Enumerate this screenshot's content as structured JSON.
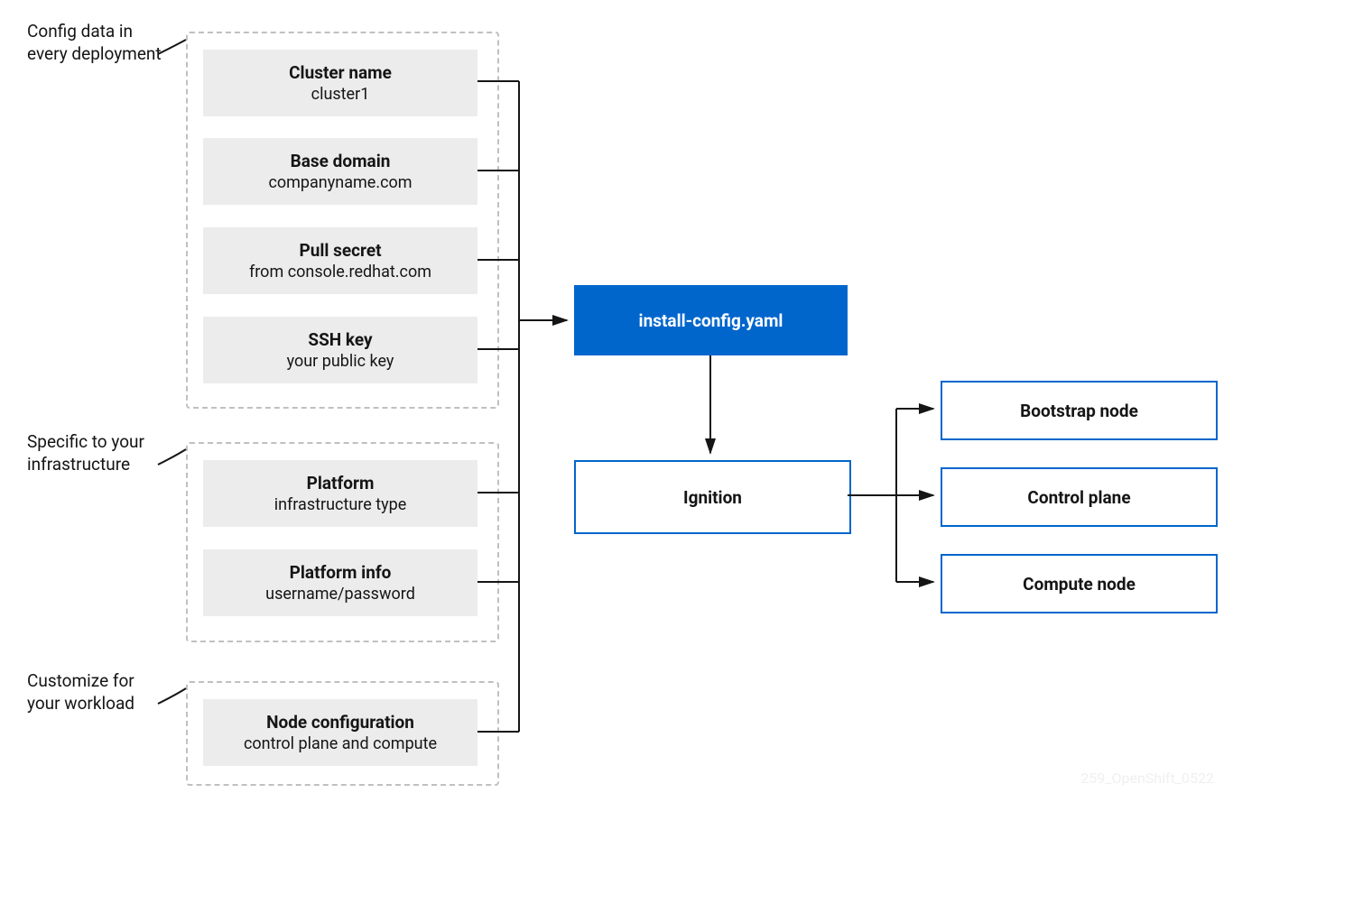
{
  "labels": {
    "configData": "Config data in\nevery deployment",
    "specific": "Specific to your\ninfrastructure",
    "customize": "Customize for\nyour workload"
  },
  "group1": [
    {
      "title": "Cluster name",
      "sub": "cluster1"
    },
    {
      "title": "Base domain",
      "sub": "companyname.com"
    },
    {
      "title": "Pull secret",
      "sub": "from console.redhat.com"
    },
    {
      "title": "SSH key",
      "sub": "your public key"
    }
  ],
  "group2": [
    {
      "title": "Platform",
      "sub": "infrastructure type"
    },
    {
      "title": "Platform info",
      "sub": "username/password"
    }
  ],
  "group3": [
    {
      "title": "Node configuration",
      "sub": "control plane and compute"
    }
  ],
  "center": {
    "installConfig": "install-config.yaml",
    "ignition": "Ignition"
  },
  "outputs": [
    "Bootstrap node",
    "Control plane",
    "Compute node"
  ],
  "watermark": "259_OpenShift_0522"
}
